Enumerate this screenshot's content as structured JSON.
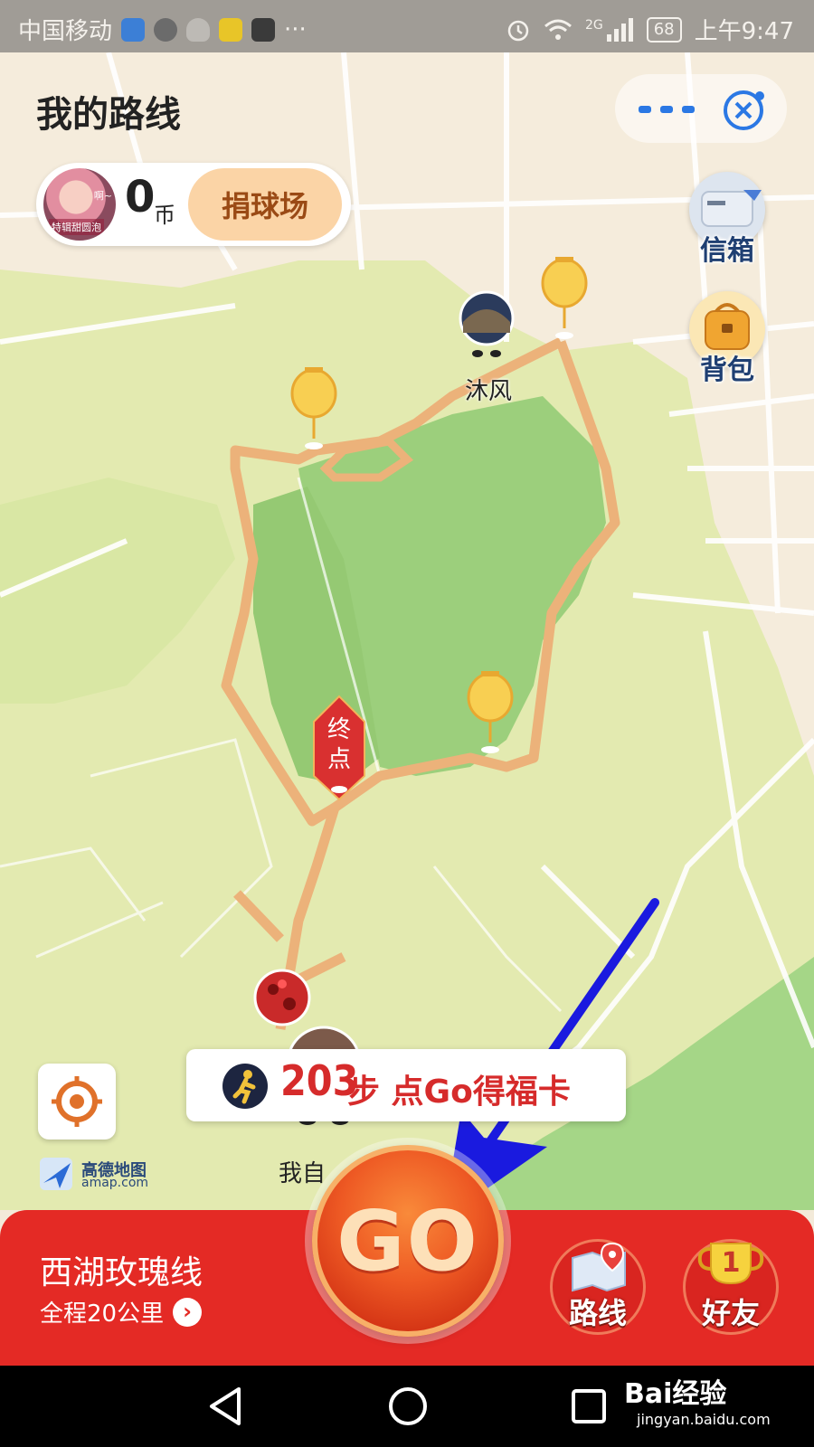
{
  "status_bar": {
    "carrier": "中国移动",
    "more": "···",
    "network": "2G",
    "battery": "68",
    "time": "上午9:47"
  },
  "header": {
    "title": "我的路线",
    "more_icon": "more-dots-icon",
    "close_icon": "close-icon"
  },
  "coin_card": {
    "avatar_tag_top": "啊~",
    "avatar_tag_bottom": "特辑甜圆泡",
    "coins": "0",
    "coin_unit": "币",
    "donate_label": "捐球场"
  },
  "side_buttons": [
    {
      "label": "信箱",
      "icon": "mailbox-icon"
    },
    {
      "label": "背包",
      "icon": "backpack-icon"
    }
  ],
  "map": {
    "end_marker": [
      "终",
      "点"
    ],
    "friend_name": "沐风",
    "me_name": "我自"
  },
  "steps": {
    "count": "203",
    "text": "步 点Go得福卡"
  },
  "amap_logo": {
    "name": "高德地图",
    "url": "amap.com"
  },
  "route": {
    "name": "西湖玫瑰线",
    "distance": "全程20公里",
    "chevron": "›"
  },
  "go_button": {
    "label": "GO"
  },
  "bottom_buttons": [
    {
      "label": "路线",
      "icon": "route-map-icon"
    },
    {
      "label": "好友",
      "icon": "friends-trophy-icon",
      "badge": "1"
    }
  ],
  "watermark": {
    "brand": "Bai经验",
    "url": "jingyan.baidu.com"
  },
  "colors": {
    "accent_red": "#e42a25",
    "route_orange": "#ecb27a",
    "park_green": "#9ccf7c",
    "arrow_blue": "#1a1adf"
  }
}
